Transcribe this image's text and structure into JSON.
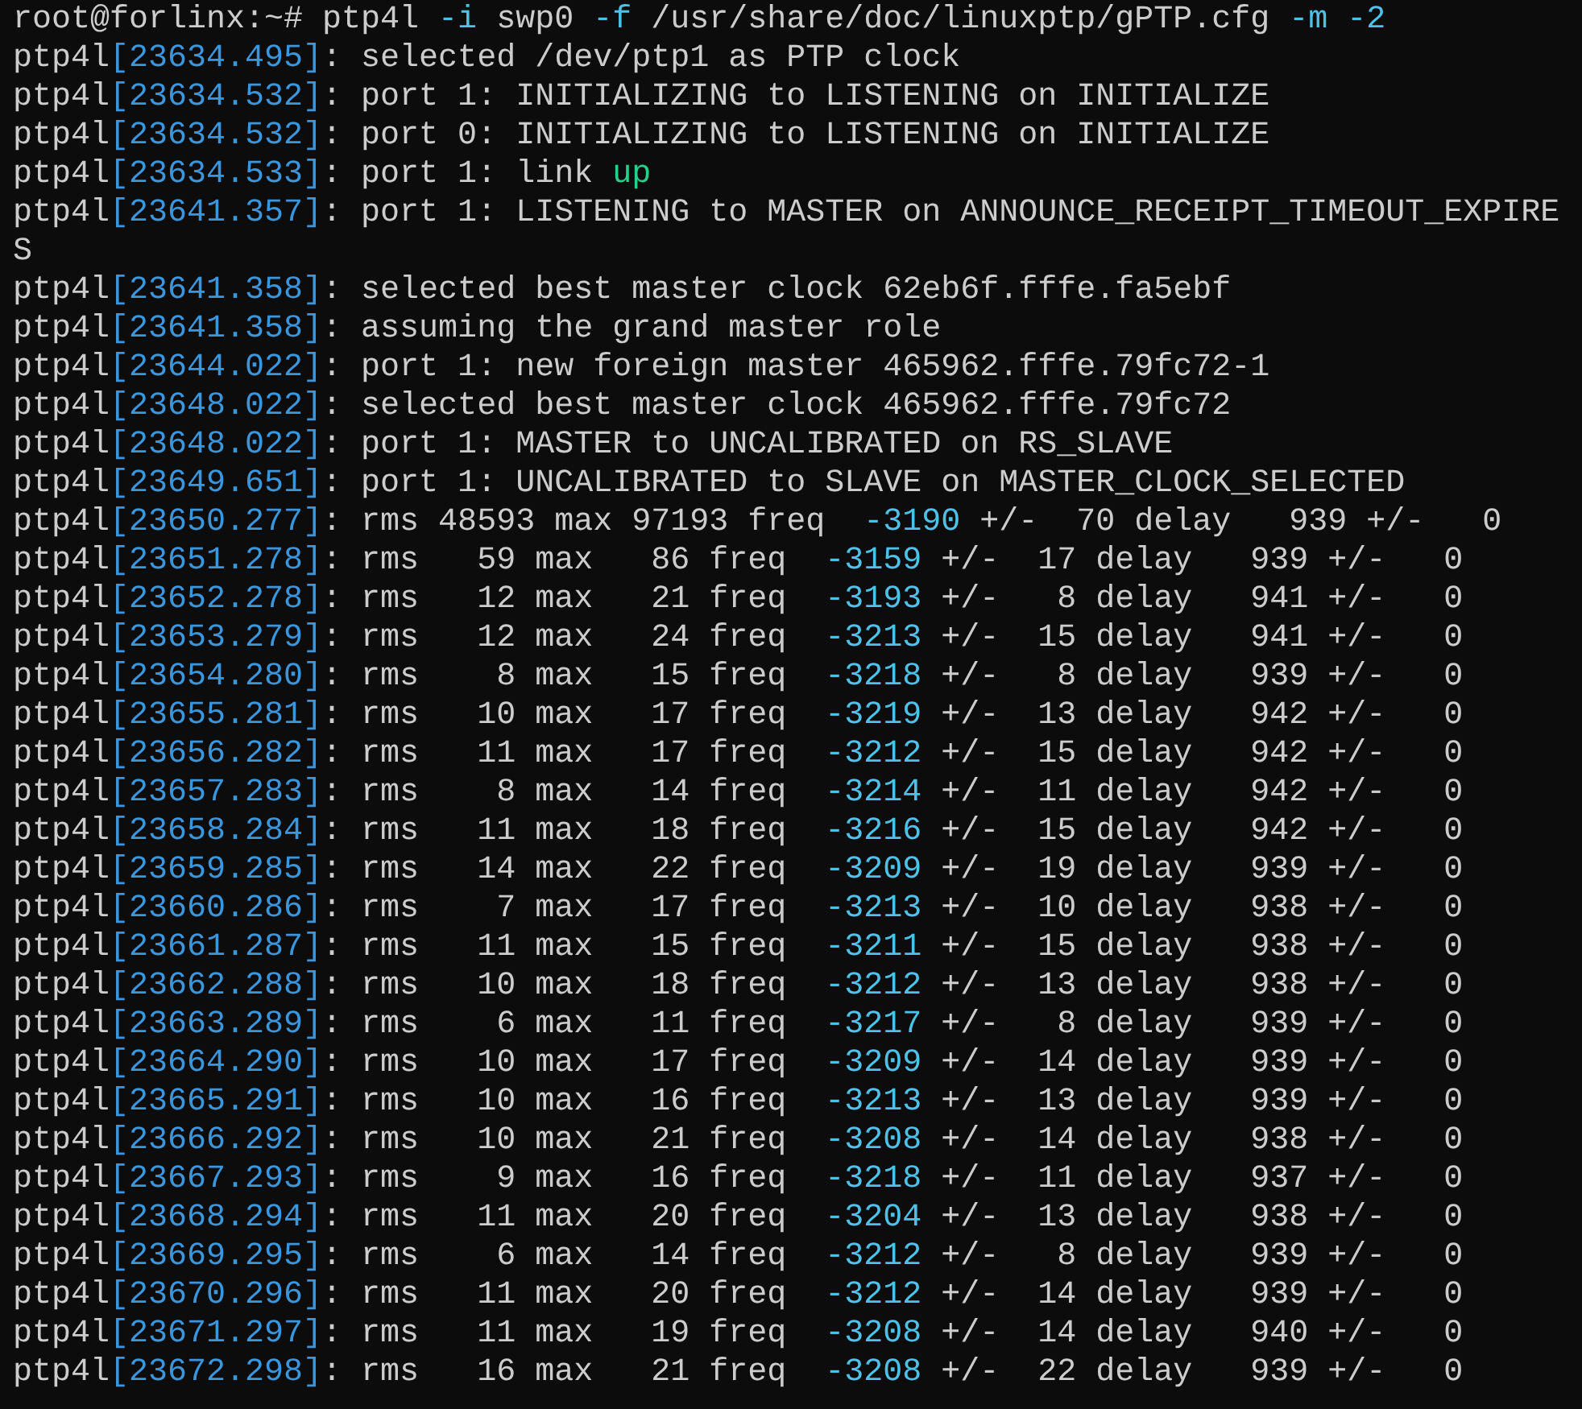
{
  "terminal": {
    "lines": [
      {
        "segments": [
          {
            "text": "root@forlinx:~# ptp4l "
          },
          {
            "text": "-i",
            "color": "#4cc2e8"
          },
          {
            "text": " swp0 "
          },
          {
            "text": "-f",
            "color": "#4cc2e8"
          },
          {
            "text": " /usr/share/doc/linuxptp/gPTP.cfg "
          },
          {
            "text": "-m -2",
            "color": "#4cc2e8"
          }
        ]
      },
      {
        "segments": [
          {
            "text": "ptp4l"
          },
          {
            "text": "[23634.495]",
            "color": "#3a96dd"
          },
          {
            "text": ": selected /dev/ptp1 as PTP clock"
          }
        ]
      },
      {
        "segments": [
          {
            "text": "ptp4l"
          },
          {
            "text": "[23634.532]",
            "color": "#3a96dd"
          },
          {
            "text": ": port 1: INITIALIZING to LISTENING on INITIALIZE"
          }
        ]
      },
      {
        "segments": [
          {
            "text": "ptp4l"
          },
          {
            "text": "[23634.532]",
            "color": "#3a96dd"
          },
          {
            "text": ": port 0: INITIALIZING to LISTENING on INITIALIZE"
          }
        ]
      },
      {
        "segments": [
          {
            "text": "ptp4l"
          },
          {
            "text": "[23634.533]",
            "color": "#3a96dd"
          },
          {
            "text": ": port 1: link "
          },
          {
            "text": "up",
            "color": "#23d18b"
          }
        ]
      },
      {
        "segments": [
          {
            "text": "ptp4l"
          },
          {
            "text": "[23641.357]",
            "color": "#3a96dd"
          },
          {
            "text": ": port 1: LISTENING to MASTER on ANNOUNCE_RECEIPT_TIMEOUT_EXPIRE"
          }
        ]
      },
      {
        "segments": [
          {
            "text": "S"
          }
        ]
      },
      {
        "segments": [
          {
            "text": "ptp4l"
          },
          {
            "text": "[23641.358]",
            "color": "#3a96dd"
          },
          {
            "text": ": selected best master clock 62eb6f.fffe.fa5ebf"
          }
        ]
      },
      {
        "segments": [
          {
            "text": "ptp4l"
          },
          {
            "text": "[23641.358]",
            "color": "#3a96dd"
          },
          {
            "text": ": assuming the grand master role"
          }
        ]
      },
      {
        "segments": [
          {
            "text": "ptp4l"
          },
          {
            "text": "[23644.022]",
            "color": "#3a96dd"
          },
          {
            "text": ": port 1: new foreign master 465962.fffe.79fc72-1"
          }
        ]
      },
      {
        "segments": [
          {
            "text": "ptp4l"
          },
          {
            "text": "[23648.022]",
            "color": "#3a96dd"
          },
          {
            "text": ": selected best master clock 465962.fffe.79fc72"
          }
        ]
      },
      {
        "segments": [
          {
            "text": "ptp4l"
          },
          {
            "text": "[23648.022]",
            "color": "#3a96dd"
          },
          {
            "text": ": port 1: MASTER to UNCALIBRATED on RS_SLAVE"
          }
        ]
      },
      {
        "segments": [
          {
            "text": "ptp4l"
          },
          {
            "text": "[23649.651]",
            "color": "#3a96dd"
          },
          {
            "text": ": port 1: UNCALIBRATED to SLAVE on MASTER_CLOCK_SELECTED"
          }
        ]
      },
      {
        "segments": [
          {
            "text": "ptp4l"
          },
          {
            "text": "[23650.277]",
            "color": "#3a96dd"
          },
          {
            "text": ": rms 48593 max 97193 freq  "
          },
          {
            "text": "-3190",
            "color": "#4cc2e8"
          },
          {
            "text": " +/-  70 delay   939 +/-   0"
          }
        ]
      },
      {
        "segments": [
          {
            "text": "ptp4l"
          },
          {
            "text": "[23651.278]",
            "color": "#3a96dd"
          },
          {
            "text": ": rms   59 max   86 freq  "
          },
          {
            "text": "-3159",
            "color": "#4cc2e8"
          },
          {
            "text": " +/-  17 delay   939 +/-   0"
          }
        ]
      },
      {
        "segments": [
          {
            "text": "ptp4l"
          },
          {
            "text": "[23652.278]",
            "color": "#3a96dd"
          },
          {
            "text": ": rms   12 max   21 freq  "
          },
          {
            "text": "-3193",
            "color": "#4cc2e8"
          },
          {
            "text": " +/-   8 delay   941 +/-   0"
          }
        ]
      },
      {
        "segments": [
          {
            "text": "ptp4l"
          },
          {
            "text": "[23653.279]",
            "color": "#3a96dd"
          },
          {
            "text": ": rms   12 max   24 freq  "
          },
          {
            "text": "-3213",
            "color": "#4cc2e8"
          },
          {
            "text": " +/-  15 delay   941 +/-   0"
          }
        ]
      },
      {
        "segments": [
          {
            "text": "ptp4l"
          },
          {
            "text": "[23654.280]",
            "color": "#3a96dd"
          },
          {
            "text": ": rms    8 max   15 freq  "
          },
          {
            "text": "-3218",
            "color": "#4cc2e8"
          },
          {
            "text": " +/-   8 delay   939 +/-   0"
          }
        ]
      },
      {
        "segments": [
          {
            "text": "ptp4l"
          },
          {
            "text": "[23655.281]",
            "color": "#3a96dd"
          },
          {
            "text": ": rms   10 max   17 freq  "
          },
          {
            "text": "-3219",
            "color": "#4cc2e8"
          },
          {
            "text": " +/-  13 delay   942 +/-   0"
          }
        ]
      },
      {
        "segments": [
          {
            "text": "ptp4l"
          },
          {
            "text": "[23656.282]",
            "color": "#3a96dd"
          },
          {
            "text": ": rms   11 max   17 freq  "
          },
          {
            "text": "-3212",
            "color": "#4cc2e8"
          },
          {
            "text": " +/-  15 delay   942 +/-   0"
          }
        ]
      },
      {
        "segments": [
          {
            "text": "ptp4l"
          },
          {
            "text": "[23657.283]",
            "color": "#3a96dd"
          },
          {
            "text": ": rms    8 max   14 freq  "
          },
          {
            "text": "-3214",
            "color": "#4cc2e8"
          },
          {
            "text": " +/-  11 delay   942 +/-   0"
          }
        ]
      },
      {
        "segments": [
          {
            "text": "ptp4l"
          },
          {
            "text": "[23658.284]",
            "color": "#3a96dd"
          },
          {
            "text": ": rms   11 max   18 freq  "
          },
          {
            "text": "-3216",
            "color": "#4cc2e8"
          },
          {
            "text": " +/-  15 delay   942 +/-   0"
          }
        ]
      },
      {
        "segments": [
          {
            "text": "ptp4l"
          },
          {
            "text": "[23659.285]",
            "color": "#3a96dd"
          },
          {
            "text": ": rms   14 max   22 freq  "
          },
          {
            "text": "-3209",
            "color": "#4cc2e8"
          },
          {
            "text": " +/-  19 delay   939 +/-   0"
          }
        ]
      },
      {
        "segments": [
          {
            "text": "ptp4l"
          },
          {
            "text": "[23660.286]",
            "color": "#3a96dd"
          },
          {
            "text": ": rms    7 max   17 freq  "
          },
          {
            "text": "-3213",
            "color": "#4cc2e8"
          },
          {
            "text": " +/-  10 delay   938 +/-   0"
          }
        ]
      },
      {
        "segments": [
          {
            "text": "ptp4l"
          },
          {
            "text": "[23661.287]",
            "color": "#3a96dd"
          },
          {
            "text": ": rms   11 max   15 freq  "
          },
          {
            "text": "-3211",
            "color": "#4cc2e8"
          },
          {
            "text": " +/-  15 delay   938 +/-   0"
          }
        ]
      },
      {
        "segments": [
          {
            "text": "ptp4l"
          },
          {
            "text": "[23662.288]",
            "color": "#3a96dd"
          },
          {
            "text": ": rms   10 max   18 freq  "
          },
          {
            "text": "-3212",
            "color": "#4cc2e8"
          },
          {
            "text": " +/-  13 delay   938 +/-   0"
          }
        ]
      },
      {
        "segments": [
          {
            "text": "ptp4l"
          },
          {
            "text": "[23663.289]",
            "color": "#3a96dd"
          },
          {
            "text": ": rms    6 max   11 freq  "
          },
          {
            "text": "-3217",
            "color": "#4cc2e8"
          },
          {
            "text": " +/-   8 delay   939 +/-   0"
          }
        ]
      },
      {
        "segments": [
          {
            "text": "ptp4l"
          },
          {
            "text": "[23664.290]",
            "color": "#3a96dd"
          },
          {
            "text": ": rms   10 max   17 freq  "
          },
          {
            "text": "-3209",
            "color": "#4cc2e8"
          },
          {
            "text": " +/-  14 delay   939 +/-   0"
          }
        ]
      },
      {
        "segments": [
          {
            "text": "ptp4l"
          },
          {
            "text": "[23665.291]",
            "color": "#3a96dd"
          },
          {
            "text": ": rms   10 max   16 freq  "
          },
          {
            "text": "-3213",
            "color": "#4cc2e8"
          },
          {
            "text": " +/-  13 delay   939 +/-   0"
          }
        ]
      },
      {
        "segments": [
          {
            "text": "ptp4l"
          },
          {
            "text": "[23666.292]",
            "color": "#3a96dd"
          },
          {
            "text": ": rms   10 max   21 freq  "
          },
          {
            "text": "-3208",
            "color": "#4cc2e8"
          },
          {
            "text": " +/-  14 delay   938 +/-   0"
          }
        ]
      },
      {
        "segments": [
          {
            "text": "ptp4l"
          },
          {
            "text": "[23667.293]",
            "color": "#3a96dd"
          },
          {
            "text": ": rms    9 max   16 freq  "
          },
          {
            "text": "-3218",
            "color": "#4cc2e8"
          },
          {
            "text": " +/-  11 delay   937 +/-   0"
          }
        ]
      },
      {
        "segments": [
          {
            "text": "ptp4l"
          },
          {
            "text": "[23668.294]",
            "color": "#3a96dd"
          },
          {
            "text": ": rms   11 max   20 freq  "
          },
          {
            "text": "-3204",
            "color": "#4cc2e8"
          },
          {
            "text": " +/-  13 delay   938 +/-   0"
          }
        ]
      },
      {
        "segments": [
          {
            "text": "ptp4l"
          },
          {
            "text": "[23669.295]",
            "color": "#3a96dd"
          },
          {
            "text": ": rms    6 max   14 freq  "
          },
          {
            "text": "-3212",
            "color": "#4cc2e8"
          },
          {
            "text": " +/-   8 delay   939 +/-   0"
          }
        ]
      },
      {
        "segments": [
          {
            "text": "ptp4l"
          },
          {
            "text": "[23670.296]",
            "color": "#3a96dd"
          },
          {
            "text": ": rms   11 max   20 freq  "
          },
          {
            "text": "-3212",
            "color": "#4cc2e8"
          },
          {
            "text": " +/-  14 delay   939 +/-   0"
          }
        ]
      },
      {
        "segments": [
          {
            "text": "ptp4l"
          },
          {
            "text": "[23671.297]",
            "color": "#3a96dd"
          },
          {
            "text": ": rms   11 max   19 freq  "
          },
          {
            "text": "-3208",
            "color": "#4cc2e8"
          },
          {
            "text": " +/-  14 delay   940 +/-   0"
          }
        ]
      },
      {
        "segments": [
          {
            "text": "ptp4l"
          },
          {
            "text": "[23672.298]",
            "color": "#3a96dd"
          },
          {
            "text": ": rms   16 max   21 freq  "
          },
          {
            "text": "-3208",
            "color": "#4cc2e8"
          },
          {
            "text": " +/-  22 delay   939 +/-   0"
          }
        ]
      }
    ]
  }
}
